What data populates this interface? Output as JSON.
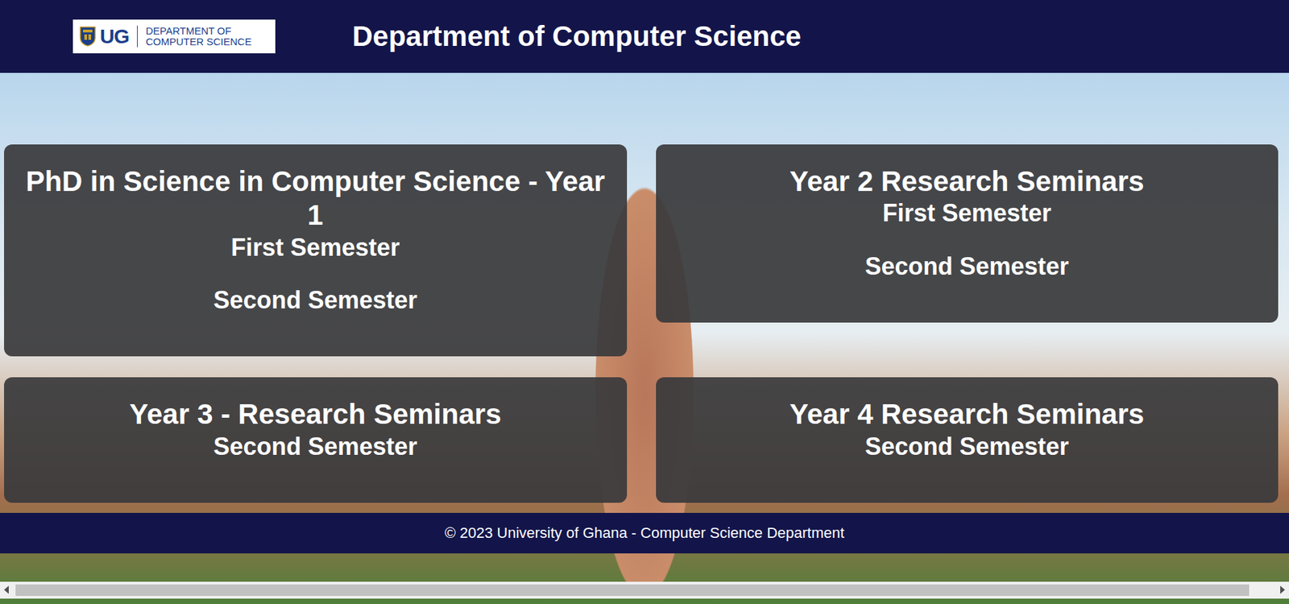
{
  "header": {
    "logo": {
      "abbr": "UG",
      "line1": "DEPARTMENT OF",
      "line2": "COMPUTER SCIENCE"
    },
    "title": "Department of Computer Science"
  },
  "programmes": [
    {
      "title": "PhD in Science in Computer Science - Year 1",
      "semesters": [
        "First Semester",
        "Second Semester"
      ]
    },
    {
      "title": "Year 2 Research Seminars",
      "semesters": [
        "First Semester",
        "Second Semester"
      ]
    },
    {
      "title": "Year 3 - Research Seminars",
      "semesters": [
        "Second Semester"
      ]
    },
    {
      "title": "Year 4 Research Seminars",
      "semesters": [
        "Second Semester"
      ]
    }
  ],
  "footer": "© 2023 University of Ghana - Computer Science Department"
}
